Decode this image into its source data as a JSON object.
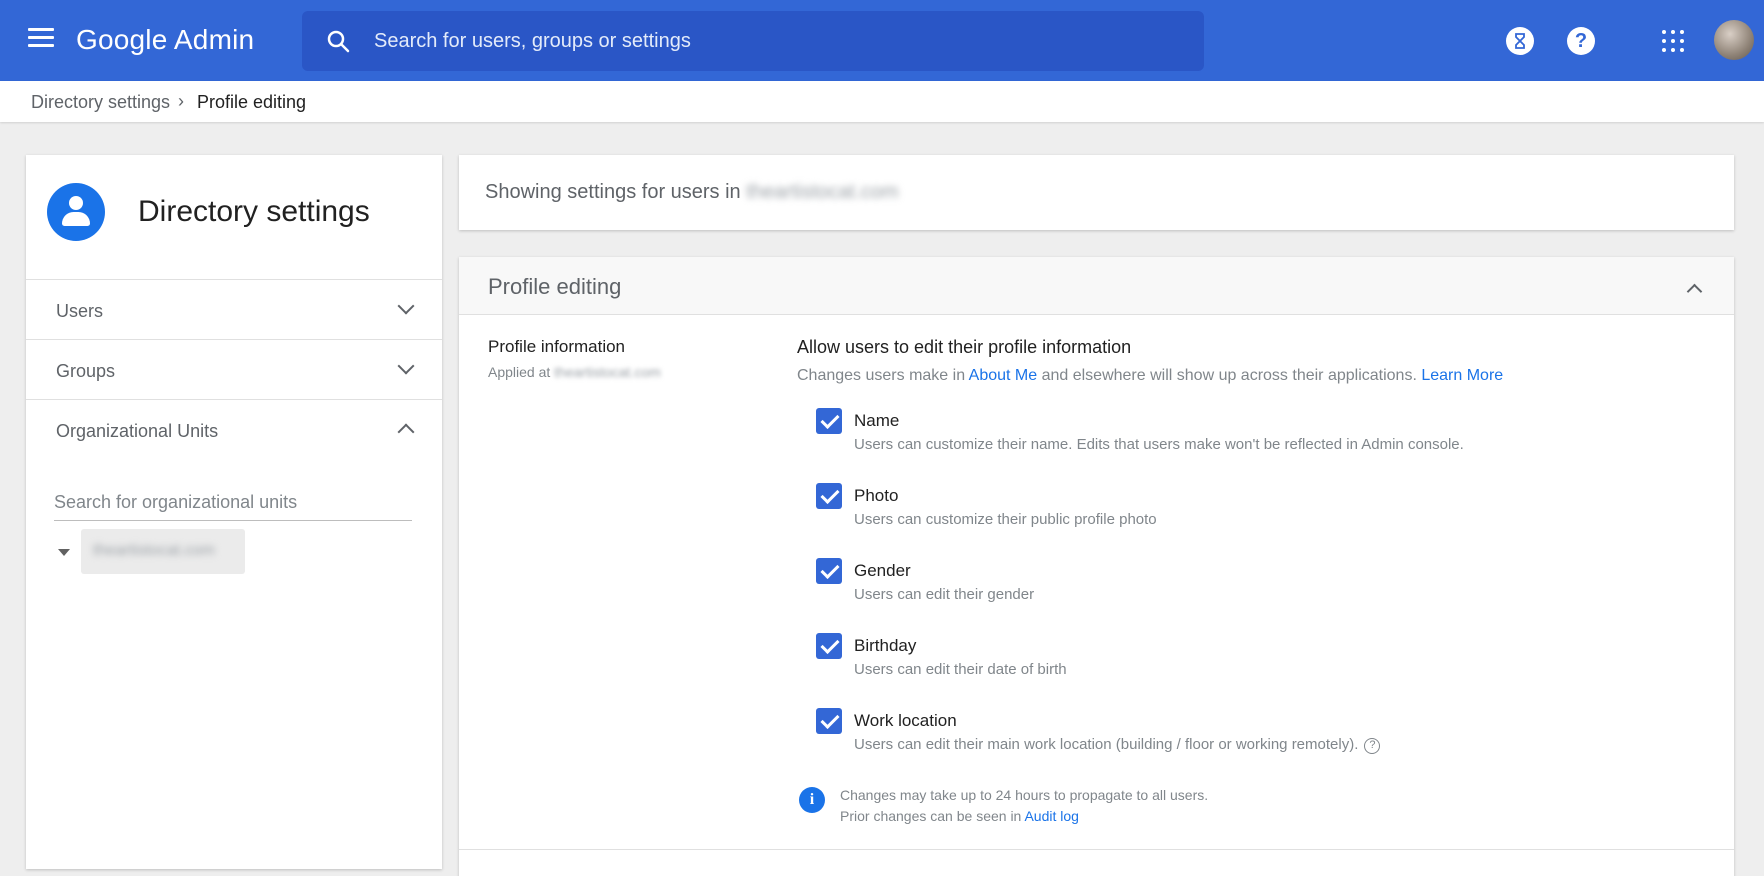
{
  "topbar": {
    "brand": "Google Admin",
    "search_placeholder": "Search for users, groups or settings",
    "help_glyph": "?",
    "icons": [
      "menu-icon",
      "search-icon",
      "hourglass-icon",
      "help-icon",
      "apps-grid-icon",
      "account-avatar"
    ]
  },
  "breadcrumb": {
    "parent": "Directory settings",
    "separator": "›",
    "current": "Profile editing"
  },
  "sidebar": {
    "title": "Directory settings",
    "sections": [
      {
        "label": "Users",
        "expanded": false
      },
      {
        "label": "Groups",
        "expanded": false
      },
      {
        "label": "Organizational Units",
        "expanded": true
      }
    ],
    "ou_search_placeholder": "Search for organizational units",
    "ou_root": "theartistocat.com"
  },
  "main": {
    "showing_prefix": "Showing settings for users in ",
    "showing_domain": "theartistocat.com",
    "card": {
      "title": "Profile editing",
      "section_title": "Profile information",
      "applied_prefix": "Applied at ",
      "applied_domain": "theartistocat.com",
      "allow_heading": "Allow users to edit their profile information",
      "changes_prefix": "Changes users make in ",
      "about_me_link": "About Me",
      "changes_middle": " and elsewhere will show up across their applications. ",
      "learn_more_link": "Learn More",
      "options": [
        {
          "name": "Name",
          "desc": "Users can customize their name. Edits that users make won't be reflected in Admin console.",
          "checked": true
        },
        {
          "name": "Photo",
          "desc": "Users can customize their public profile photo",
          "checked": true
        },
        {
          "name": "Gender",
          "desc": "Users can edit their gender",
          "checked": true
        },
        {
          "name": "Birthday",
          "desc": "Users can edit their date of birth",
          "checked": true
        },
        {
          "name": "Work location",
          "desc": "Users can edit their main work location (building / floor or working remotely).",
          "checked": true
        }
      ],
      "help_glyph": "?",
      "info_glyph": "i",
      "note_line1": "Changes may take up to 24 hours to propagate to all users.",
      "note_line2_prefix": "Prior changes can be seen in ",
      "audit_log_link": "Audit log"
    }
  },
  "colors": {
    "brand_blue": "#3367d6",
    "link_blue": "#1a73e8",
    "background": "#eeeeee"
  }
}
